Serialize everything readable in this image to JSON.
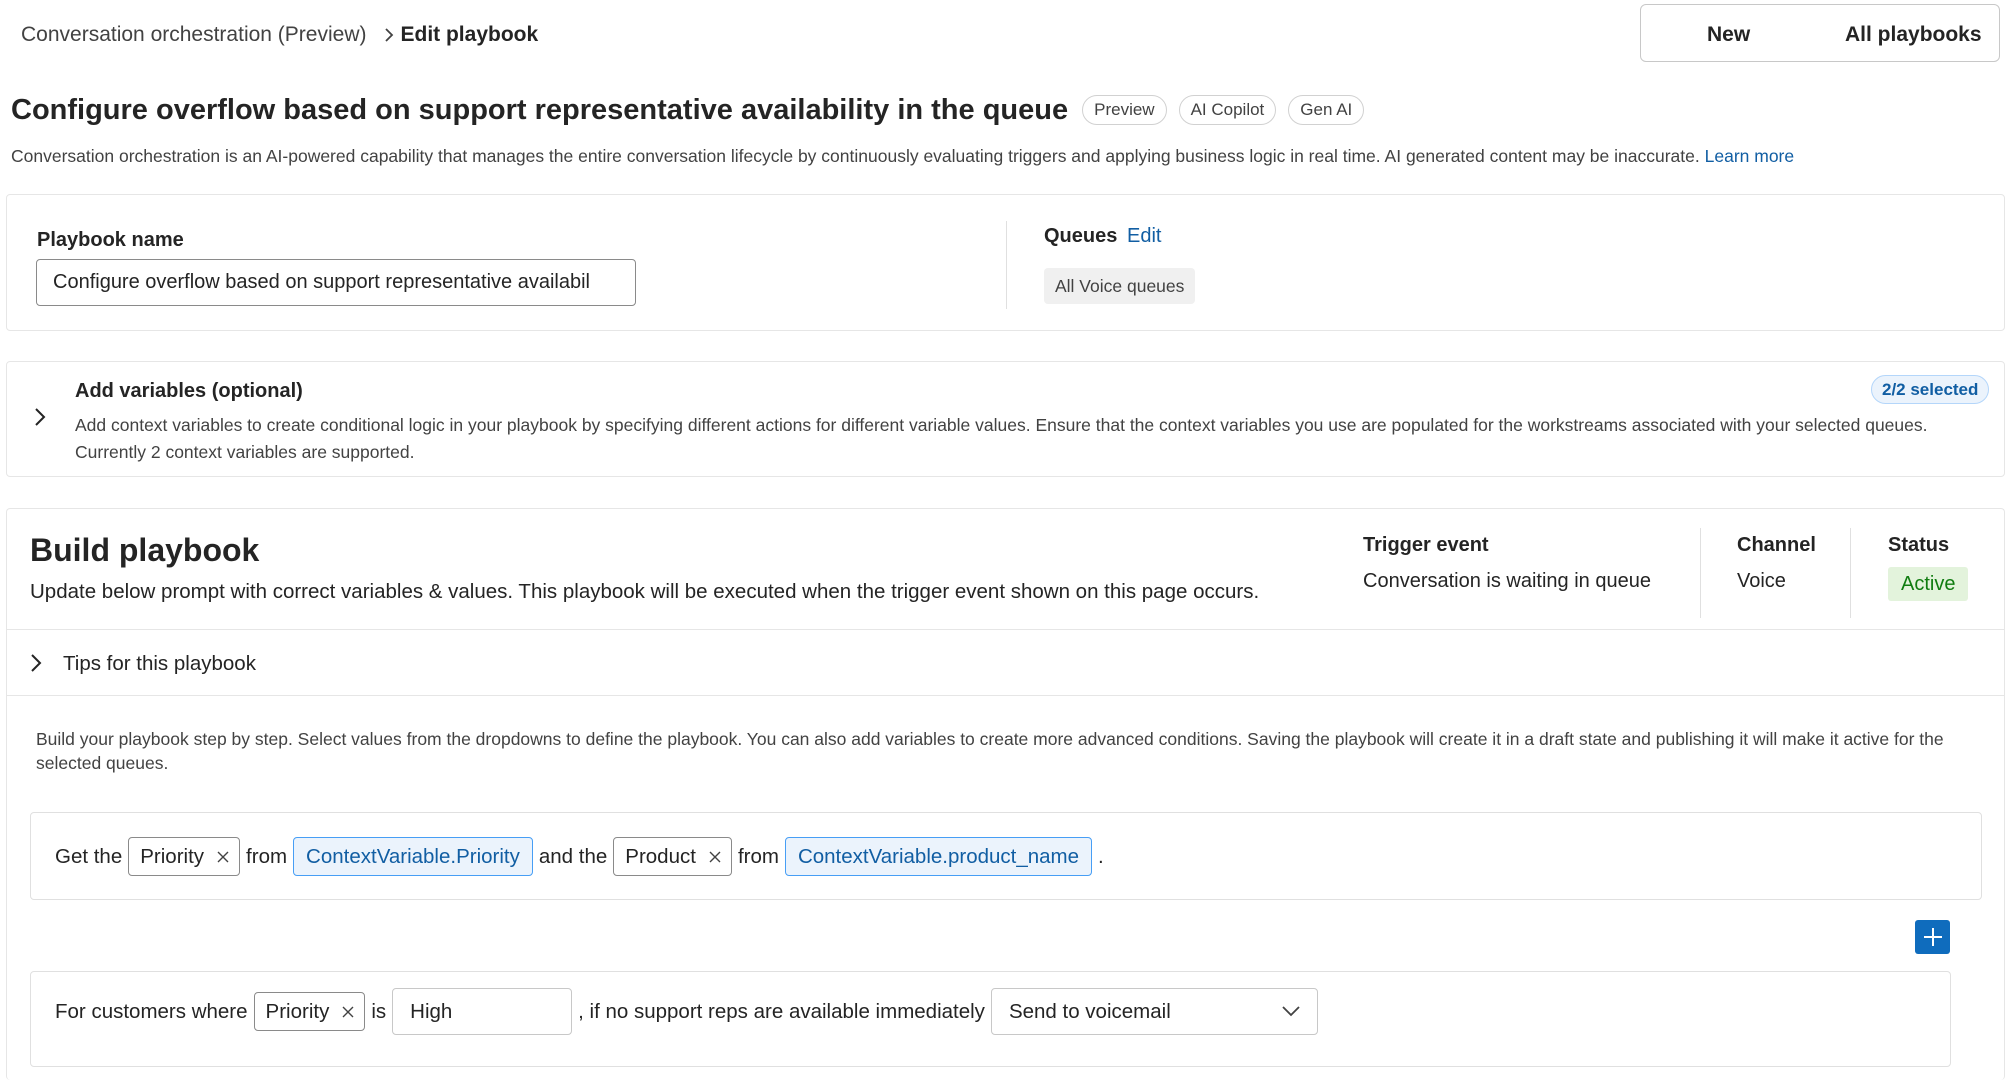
{
  "breadcrumb": {
    "parent": "Conversation orchestration (Preview)",
    "current": "Edit playbook"
  },
  "top_actions": {
    "new_label": "New",
    "all_label": "All playbooks"
  },
  "page": {
    "title": "Configure overflow based on support representative availability in the queue",
    "tags": [
      "Preview",
      "AI Copilot",
      "Gen AI"
    ],
    "description": "Conversation orchestration is an AI-powered capability that manages the entire conversation lifecycle by continuously evaluating triggers and applying business logic in real time. AI generated content may be inaccurate.",
    "learn_more": "Learn more"
  },
  "playbook_name": {
    "label": "Playbook name",
    "value": "Configure overflow based on support representative availabil"
  },
  "queues": {
    "label": "Queues",
    "edit_label": "Edit",
    "chip": "All Voice queues"
  },
  "variables": {
    "title": "Add variables (optional)",
    "description": "Add context variables to create conditional logic in your playbook by specifying different actions for different variable values. Ensure that the context variables you use are populated for the workstreams associated with your selected queues. Currently 2 context variables are supported.",
    "badge": "2/2 selected"
  },
  "build": {
    "title": "Build playbook",
    "subtitle": "Update below prompt with correct variables & values. This playbook will be executed when the trigger event shown on this page occurs.",
    "trigger_label": "Trigger event",
    "trigger_value": "Conversation is waiting in queue",
    "channel_label": "Channel",
    "channel_value": "Voice",
    "status_label": "Status",
    "status_value": "Active",
    "tips_label": "Tips for this playbook",
    "help_text": "Build your playbook step by step. Select values from the dropdowns to define the playbook. You can also add variables to create more advanced conditions. Saving the playbook will create it in a draft state and publishing it will make it active for the selected queues."
  },
  "step1": {
    "get_the": "Get the",
    "var1": "Priority",
    "from1": "from",
    "source1": "ContextVariable.Priority",
    "and_the": "and the",
    "var2": "Product",
    "from2": "from",
    "source2": "ContextVariable.product_name",
    "period": "."
  },
  "step2": {
    "for_customers": "For customers where",
    "var": "Priority",
    "is": "is",
    "value": "High",
    "clause": ", if no support reps are available immediately",
    "action": "Send to voicemail"
  },
  "colors": {
    "accent": "#0f6cbd",
    "link": "#115ea3",
    "status_bg": "#e3f3dc",
    "status_fg": "#107c10"
  }
}
